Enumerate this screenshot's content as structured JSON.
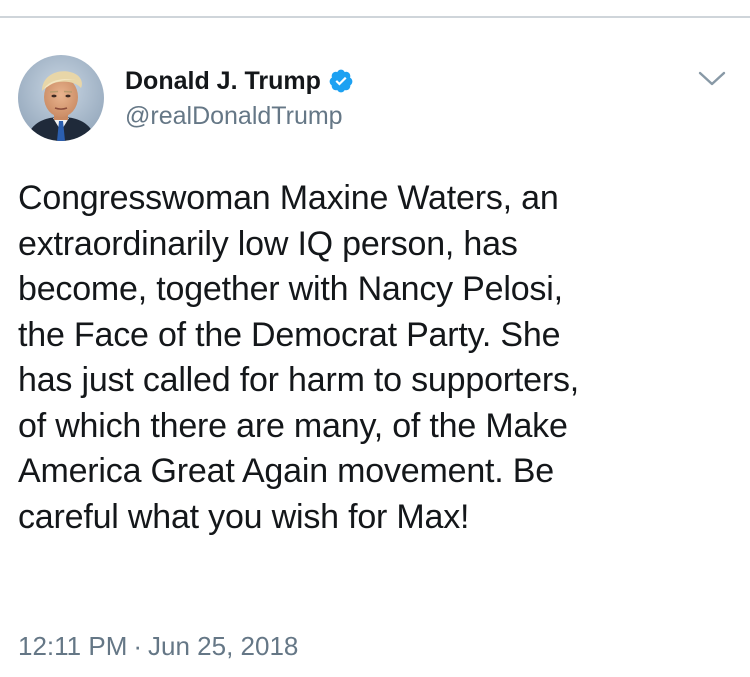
{
  "tweet": {
    "author": {
      "display_name": "Donald J. Trump",
      "handle": "@realDonaldTrump",
      "verified": true,
      "avatar_icon": "profile-photo-avatar",
      "verified_icon": "verified-badge-icon"
    },
    "menu_icon": "chevron-down-icon",
    "text_lines": [
      "Congresswoman Maxine Waters, an",
      "extraordinarily low IQ person, has",
      "become, together with Nancy Pelosi,",
      "the Face of the Democrat Party. She",
      "has just called for harm to supporters,",
      "of which there are many, of the Make",
      "America Great Again movement. Be",
      "careful what you wish for Max!"
    ],
    "time": "12:11 PM",
    "separator": "·",
    "date": "Jun 25, 2018"
  },
  "colors": {
    "text_primary": "#14171a",
    "text_secondary": "#657786",
    "verified_blue": "#1da1f2",
    "divider": "#cfd5da"
  }
}
